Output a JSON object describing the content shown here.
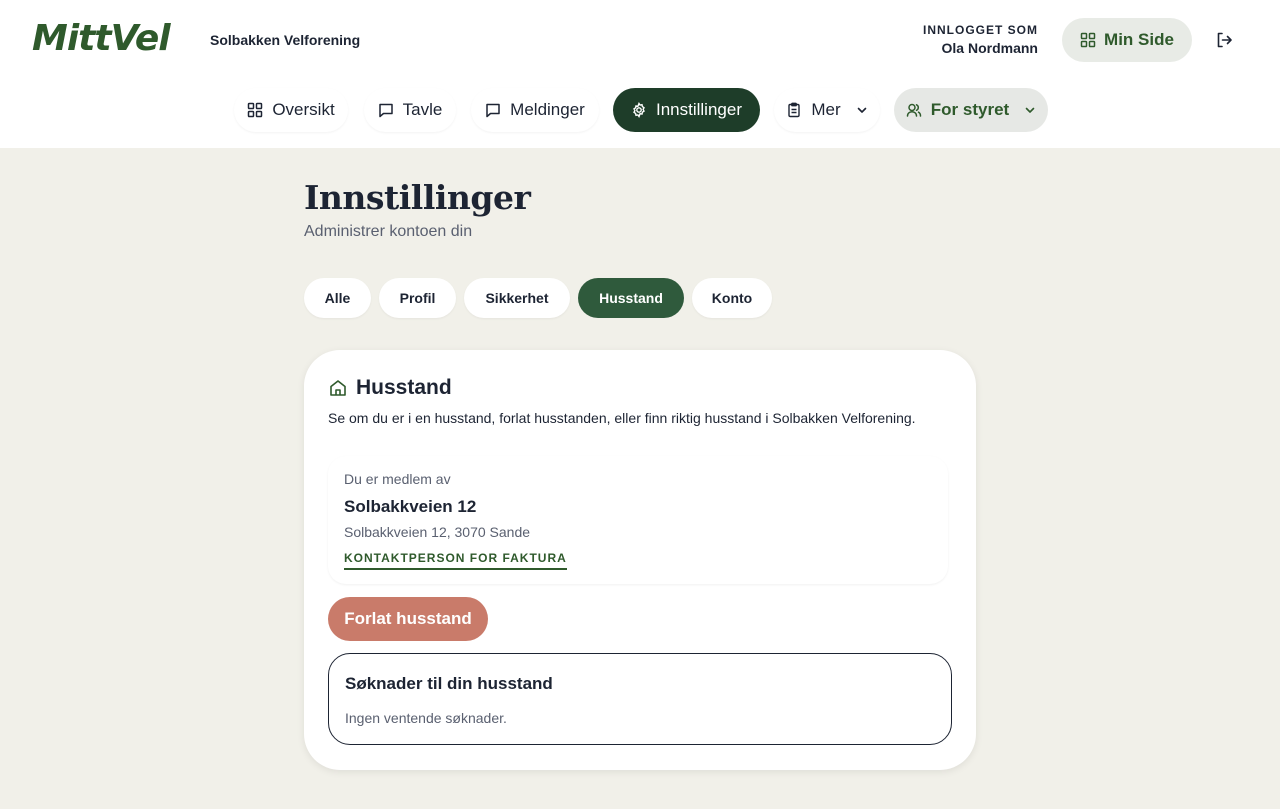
{
  "brand": {
    "logo_text": "MittVel",
    "org_name": "Solbakken Velforening",
    "accent": "#2f5a2c"
  },
  "user": {
    "caption": "INNLOGGET SOM",
    "name": "Ola Nordmann",
    "min_side_label": "Min Side"
  },
  "nav": {
    "oversikt": "Oversikt",
    "tavle": "Tavle",
    "meldinger": "Meldinger",
    "innstillinger": "Innstillinger",
    "mer": "Mer",
    "for_styret": "For styret"
  },
  "page": {
    "title": "Innstillinger",
    "subtitle": "Administrer kontoen din"
  },
  "tabs": {
    "alle": "Alle",
    "profil": "Profil",
    "sikkerhet": "Sikkerhet",
    "husstand": "Husstand",
    "konto": "Konto",
    "active": "Husstand"
  },
  "household": {
    "title": "Husstand",
    "description": "Se om du er i en husstand, forlat husstanden, eller finn riktig husstand i Solbakken Velforening.",
    "member_caption": "Du er medlem av",
    "address": "Solbakkveien 12",
    "full_address": "Solbakkveien 12, 3070 Sande",
    "role": "KONTAKTPERSON FOR FAKTURA",
    "leave_label": "Forlat husstand",
    "requests_title": "Søknader til din husstand",
    "requests_empty": "Ingen ventende søknader."
  },
  "icons": {
    "min_side": "grid-icon",
    "logout": "logout-icon",
    "oversikt": "grid-icon",
    "tavle": "message-square-icon",
    "meldinger": "message-square-icon",
    "innstillinger": "gear-icon",
    "mer": "clipboard-icon",
    "for_styret": "users-icon",
    "husstand": "home-icon"
  },
  "colors": {
    "active_nav": "#1e3d29",
    "active_tab": "#2f5a3c",
    "danger": "#c97b6a",
    "background": "#f1f0e9"
  }
}
